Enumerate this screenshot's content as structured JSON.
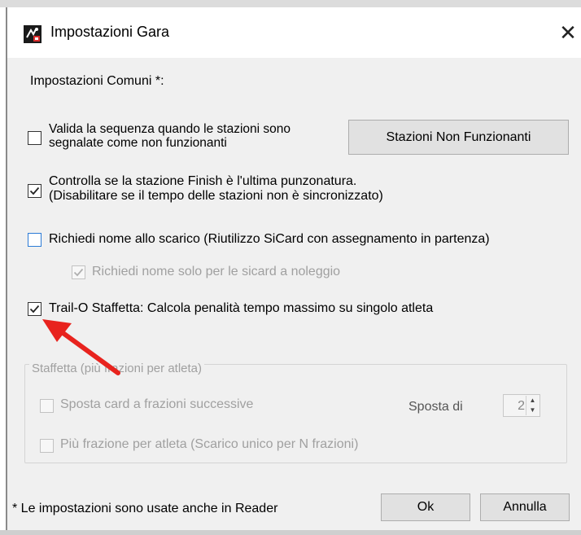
{
  "window": {
    "title": "Impostazioni Gara",
    "close_glyph": "✕",
    "app_icon": "race-settings-app-icon"
  },
  "section_label": "Impostazioni Comuni *:",
  "options": {
    "valida_sequenza": {
      "line1": "Valida la sequenza quando le stazioni sono",
      "line2": "segnalate come non funzionanti",
      "checked": false
    },
    "stazioni_button": "Stazioni Non Funzionanti",
    "controlla_finish": {
      "line1": "Controlla se la stazione Finish è l'ultima punzonatura.",
      "line2": "(Disabilitare se il tempo delle stazioni non è sincronizzato)",
      "checked": true
    },
    "richiedi_nome": {
      "label": "Richiedi nome allo scarico (Riutilizzo SiCard con assegnamento in partenza)",
      "checked": false
    },
    "richiedi_nome_noleggio": {
      "label": "Richiedi nome solo per le sicard a noleggio",
      "checked": true,
      "enabled": false
    },
    "trail_o": {
      "label": "Trail-O Staffetta: Calcola penalità tempo massimo su singolo atleta",
      "checked": true
    }
  },
  "staffetta_group": {
    "legend": "Staffetta (più frazioni per atleta)",
    "sposta_card": {
      "label": "Sposta card a frazioni successive",
      "checked": false,
      "enabled": false
    },
    "sposta_di_label": "Sposta di",
    "sposta_di_value": "2",
    "piu_frazione": {
      "label": "Più frazione per atleta (Scarico unico per N frazioni)",
      "checked": false,
      "enabled": false
    }
  },
  "footnote": "* Le impostazioni sono usate anche in Reader",
  "buttons": {
    "ok": "Ok",
    "annulla": "Annulla"
  },
  "annotation": {
    "arrow_color": "#e8231e"
  },
  "colors": {
    "focus_blue": "#2b7bd6",
    "dialog_bg": "#f0f0f0"
  }
}
